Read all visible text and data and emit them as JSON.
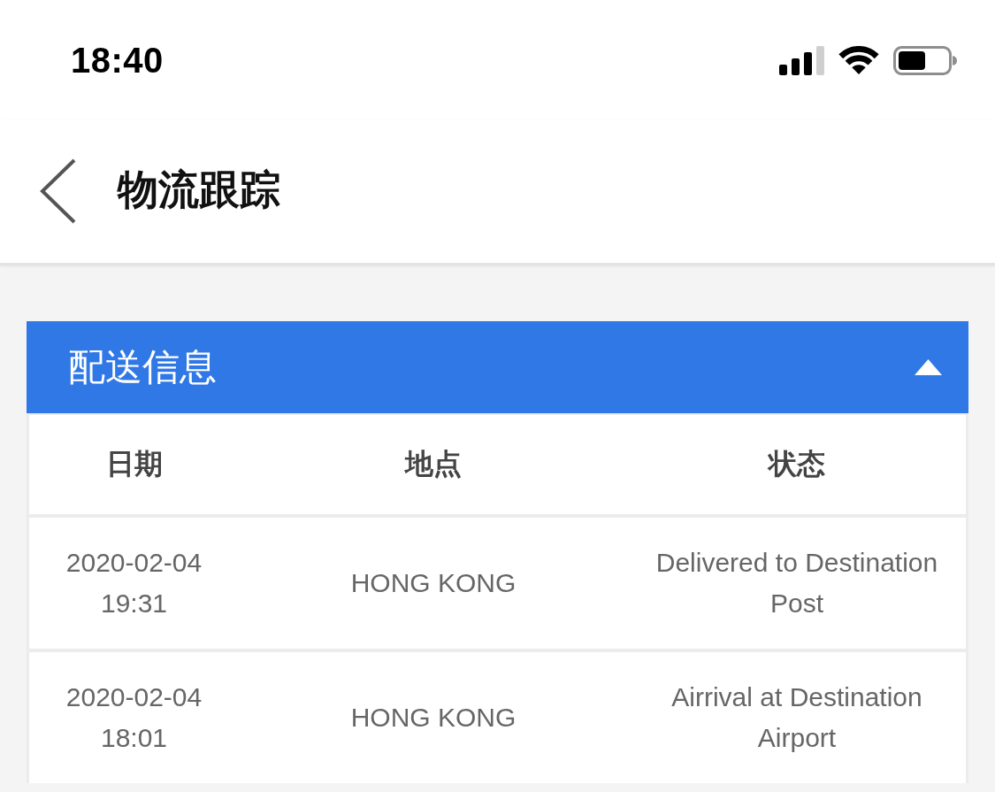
{
  "status_bar": {
    "time": "18:40"
  },
  "nav_bar": {
    "title": "物流跟踪"
  },
  "delivery_section": {
    "title": "配送信息",
    "expanded": true,
    "table": {
      "columns": [
        "日期",
        "地点",
        "状态"
      ],
      "rows": [
        {
          "date_time": "2020-02-04 19:31",
          "location": "HONG KONG",
          "status": "Delivered to Destination Post"
        },
        {
          "date_time": "2020-02-04 18:01",
          "location": "HONG KONG",
          "status": "Airrival at Destination Airport"
        }
      ]
    }
  }
}
